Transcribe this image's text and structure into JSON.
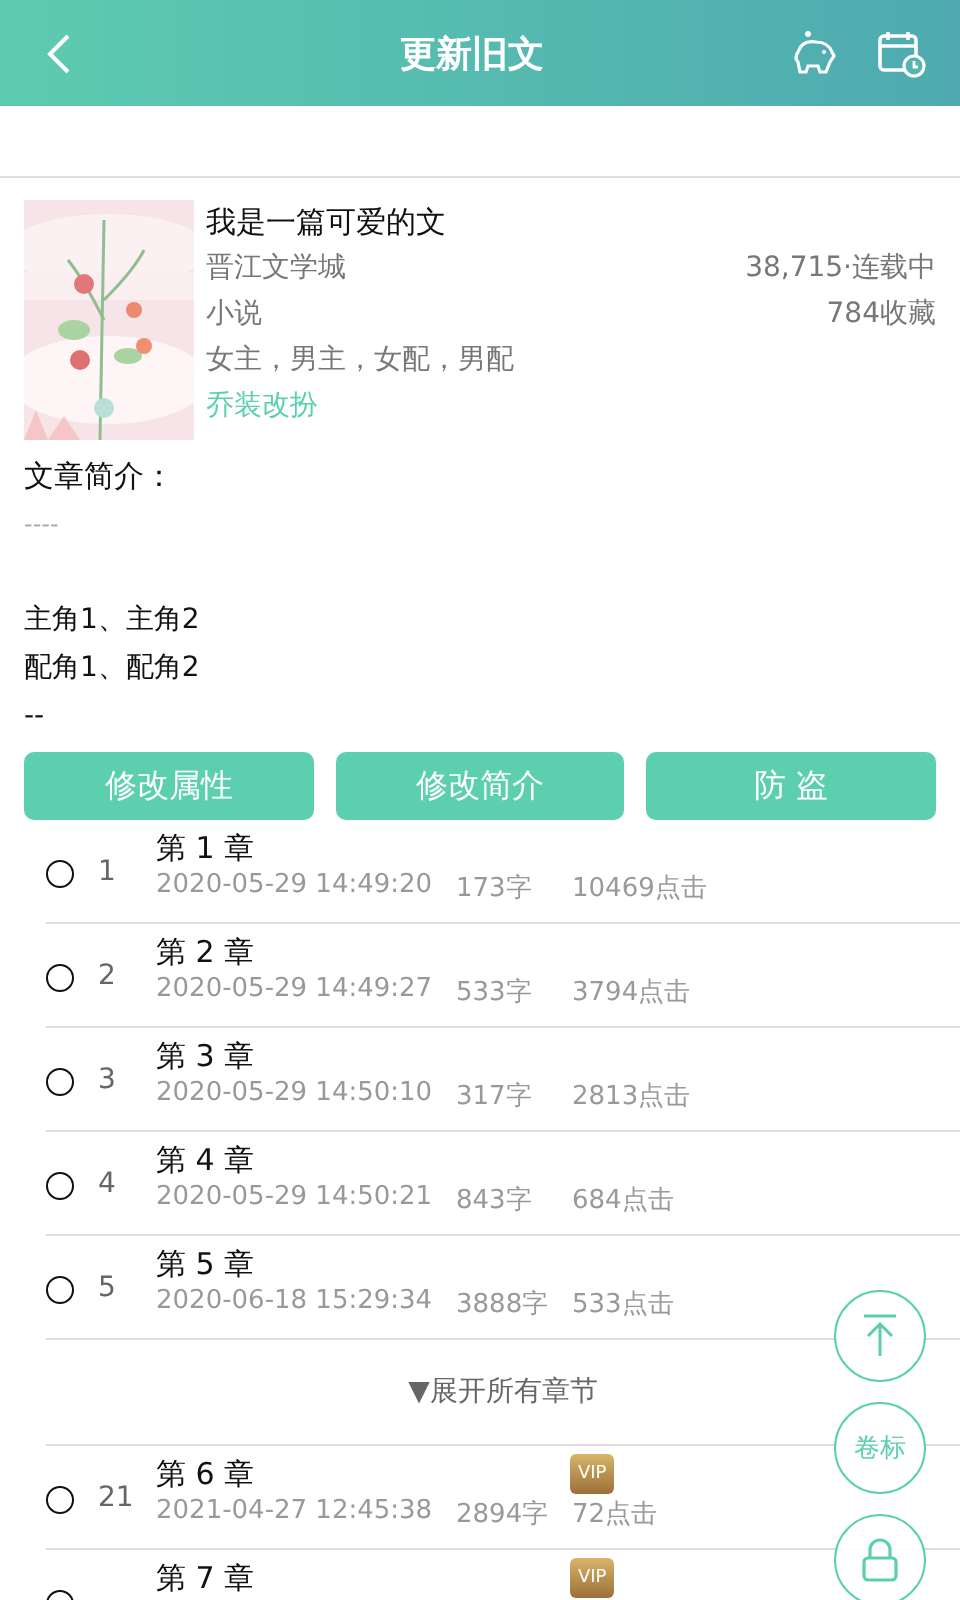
{
  "header": {
    "title": "更新旧文"
  },
  "book": {
    "title": "我是一篇可爱的文",
    "site": "晋江文学城",
    "stats": "38,715·连载中",
    "genre": "小说",
    "favorites": "784收藏",
    "roles": "女主，男主，女配，男配",
    "action_link": "乔装改扮"
  },
  "intro": {
    "label": "文章简介：",
    "divider": "----",
    "lines": [
      "主角1、主角2",
      "配角1、配角2",
      "--"
    ]
  },
  "buttons": [
    {
      "label": "修改属性"
    },
    {
      "label": "修改简介"
    },
    {
      "label": "防 盗"
    }
  ],
  "chapters": [
    {
      "selected": false,
      "number": "1",
      "title": "第 1 章",
      "time": "2020-05-29 14:49:20",
      "words": "173字",
      "clicks": "10469点击",
      "vip": false
    },
    {
      "selected": false,
      "number": "2",
      "title": "第 2 章",
      "time": "2020-05-29 14:49:27",
      "words": "533字",
      "clicks": "3794点击",
      "vip": false
    },
    {
      "selected": false,
      "number": "3",
      "title": "第 3 章",
      "time": "2020-05-29 14:50:10",
      "words": "317字",
      "clicks": "2813点击",
      "vip": false
    },
    {
      "selected": false,
      "number": "4",
      "title": "第 4 章",
      "time": "2020-05-29 14:50:21",
      "words": "843字",
      "clicks": "684点击",
      "vip": false
    },
    {
      "selected": false,
      "number": "5",
      "title": "第 5 章",
      "time": "2020-06-18 15:29:34",
      "words": "3888字",
      "clicks": "533点击",
      "vip": false
    }
  ],
  "expand": {
    "label": "▼展开所有章节"
  },
  "more_chapters": [
    {
      "selected": false,
      "number": "21",
      "title": "第 6 章",
      "time": "2021-04-27 12:45:38",
      "words": "2894字",
      "clicks": "72点击",
      "vip": true,
      "vip_label": "VIP"
    },
    {
      "selected": false,
      "title": "第 7 章",
      "vip": true,
      "vip_label": "VIP"
    }
  ],
  "floating": {
    "volume_label": "卷标"
  }
}
